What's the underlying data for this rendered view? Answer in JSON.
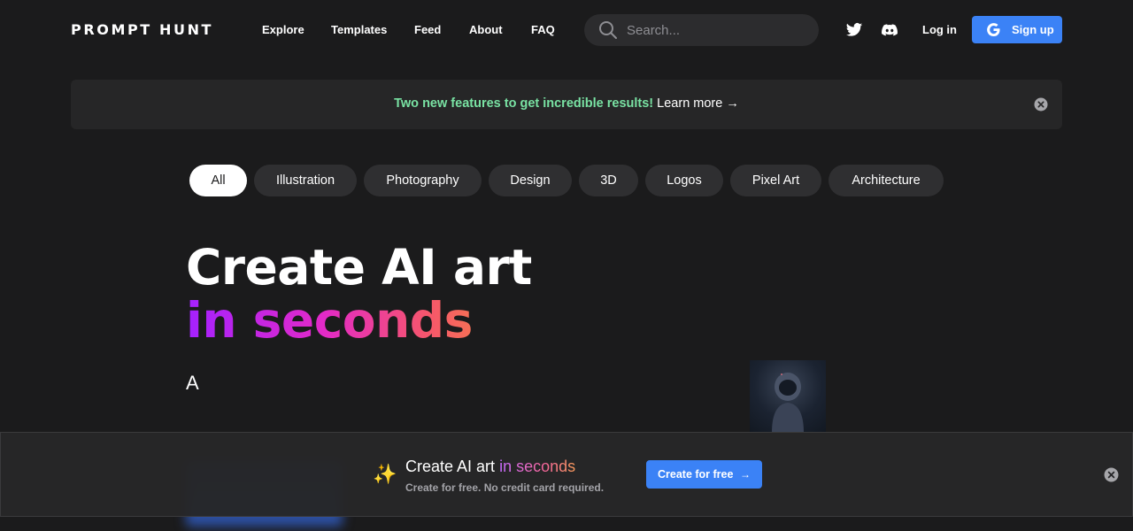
{
  "header": {
    "logo": "PROMPT HUNT",
    "nav": [
      "Explore",
      "Templates",
      "Feed",
      "About",
      "FAQ"
    ],
    "search_placeholder": "Search...",
    "login_label": "Log in",
    "signup_label": "Sign up"
  },
  "banner": {
    "highlight": "Two new features to get incredible results!",
    "link": "Learn more →"
  },
  "categories": [
    "All",
    "Illustration",
    "Photography",
    "Design",
    "3D",
    "Logos",
    "Pixel Art",
    "Architecture"
  ],
  "hero": {
    "line1": "Create AI art",
    "line2": "in seconds",
    "typed": "A"
  },
  "bottom_bar": {
    "sparkle": "✨",
    "title_plain": "Create AI art",
    "title_accent": "in seconds",
    "subtitle": "Create for free. No credit card required.",
    "cta_label": "Create for free",
    "cta_arrow": "→"
  },
  "colors": {
    "background": "#1b1b1c",
    "accent_blue": "#3b82f6",
    "banner_green": "#79e2a3",
    "gradient": [
      "#a421ff",
      "#e32ac7",
      "#f6566b",
      "#f7913a"
    ]
  }
}
